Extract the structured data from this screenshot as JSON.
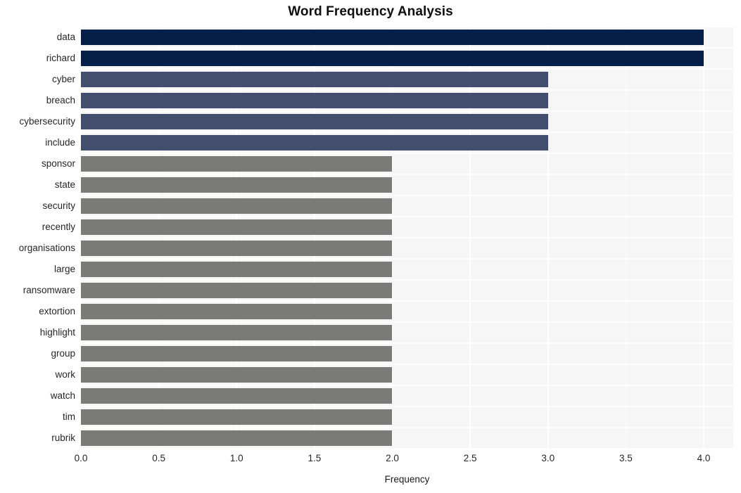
{
  "chart_data": {
    "type": "bar",
    "orientation": "horizontal",
    "title": "Word Frequency Analysis",
    "xlabel": "Frequency",
    "ylabel": "",
    "categories": [
      "data",
      "richard",
      "cyber",
      "breach",
      "cybersecurity",
      "include",
      "sponsor",
      "state",
      "security",
      "recently",
      "organisations",
      "large",
      "ransomware",
      "extortion",
      "highlight",
      "group",
      "work",
      "watch",
      "tim",
      "rubrik"
    ],
    "values": [
      4,
      4,
      3,
      3,
      3,
      3,
      2,
      2,
      2,
      2,
      2,
      2,
      2,
      2,
      2,
      2,
      2,
      2,
      2,
      2
    ],
    "xlim": [
      0,
      4.19
    ],
    "xticks": [
      0.0,
      0.5,
      1.0,
      1.5,
      2.0,
      2.5,
      3.0,
      3.5,
      4.0
    ],
    "xtick_labels": [
      "0.0",
      "0.5",
      "1.0",
      "1.5",
      "2.0",
      "2.5",
      "3.0",
      "3.5",
      "4.0"
    ],
    "grid": true,
    "legend": "none",
    "bar_colors": [
      "#042049",
      "#042049",
      "#434d6d",
      "#434d6d",
      "#434d6d",
      "#434d6d",
      "#7a7a78",
      "#7a7a78",
      "#7a7a78",
      "#7a7a78",
      "#7a7a78",
      "#7a7a78",
      "#7a7a78",
      "#7a7a78",
      "#7a7a78",
      "#7a7a78",
      "#7a7a78",
      "#7a7a78",
      "#7a7a78",
      "#7a7a78"
    ],
    "colors": {
      "figure_background": "#ffffff",
      "plot_background": "#f6f6f7",
      "gridline": "#ffffff",
      "title_text": "#0f0f0f",
      "tick_text": "#262626",
      "value_4": "#042049",
      "value_3": "#434d6d",
      "value_2": "#7a7a78"
    }
  }
}
